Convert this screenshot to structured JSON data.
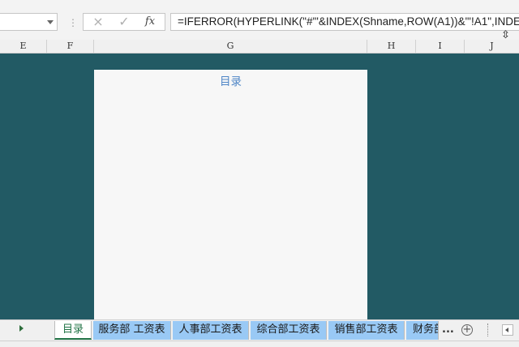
{
  "formula_bar": {
    "cancel_icon": "×",
    "enter_icon": "✓",
    "fx_label": "fx",
    "formula": "=IFERROR(HYPERLINK(\"#'\"&INDEX(Shname,ROW(A1))&\"'!A1\",INDEX("
  },
  "columns": [
    "E",
    "F",
    "G",
    "H",
    "I",
    "J"
  ],
  "sheet": {
    "title": "目录"
  },
  "tabs": [
    {
      "label": "目录",
      "active": true
    },
    {
      "label": "服务部 工资表",
      "active": false
    },
    {
      "label": "人事部工资表",
      "active": false
    },
    {
      "label": "综合部工资表",
      "active": false
    },
    {
      "label": "销售部工资表",
      "active": false
    },
    {
      "label": "财务部",
      "active": false
    }
  ],
  "tabbar": {
    "more": "...",
    "add": "+"
  },
  "colors": {
    "background": "#225a64",
    "tab_inactive": "#99c9f5",
    "tab_active_text": "#217346",
    "title_text": "#4f86c6"
  }
}
